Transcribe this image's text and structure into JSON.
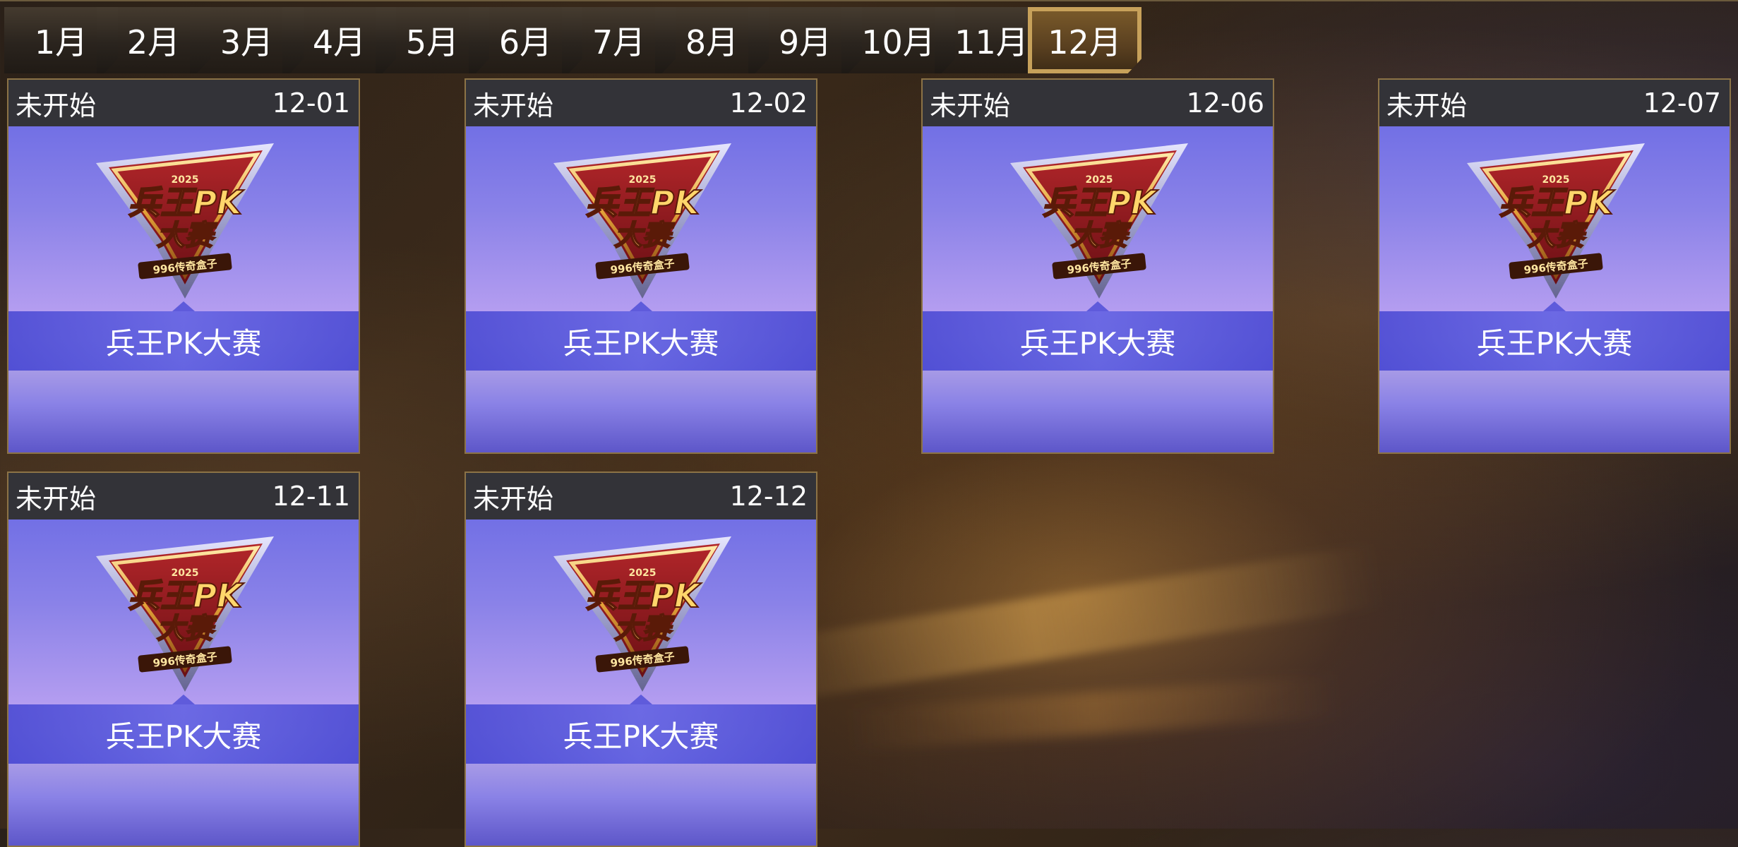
{
  "months": [
    {
      "label": "1月",
      "active": false
    },
    {
      "label": "2月",
      "active": false
    },
    {
      "label": "3月",
      "active": false
    },
    {
      "label": "4月",
      "active": false
    },
    {
      "label": "5月",
      "active": false
    },
    {
      "label": "6月",
      "active": false
    },
    {
      "label": "7月",
      "active": false
    },
    {
      "label": "8月",
      "active": false
    },
    {
      "label": "9月",
      "active": false
    },
    {
      "label": "10月",
      "active": false
    },
    {
      "label": "11月",
      "active": false
    },
    {
      "label": "12月",
      "active": true
    }
  ],
  "events": [
    {
      "status": "未开始",
      "date": "12-01",
      "title": "兵王PK大赛",
      "logo": {
        "year": "2025",
        "line1": "兵王PK",
        "line2": "大赛",
        "tag": "996传奇盒子"
      }
    },
    {
      "status": "未开始",
      "date": "12-02",
      "title": "兵王PK大赛",
      "logo": {
        "year": "2025",
        "line1": "兵王PK",
        "line2": "大赛",
        "tag": "996传奇盒子"
      }
    },
    {
      "status": "未开始",
      "date": "12-06",
      "title": "兵王PK大赛",
      "logo": {
        "year": "2025",
        "line1": "兵王PK",
        "line2": "大赛",
        "tag": "996传奇盒子"
      }
    },
    {
      "status": "未开始",
      "date": "12-07",
      "title": "兵王PK大赛",
      "logo": {
        "year": "2025",
        "line1": "兵王PK",
        "line2": "大赛",
        "tag": "996传奇盒子"
      }
    },
    {
      "status": "未开始",
      "date": "12-11",
      "title": "兵王PK大赛",
      "logo": {
        "year": "2025",
        "line1": "兵王PK",
        "line2": "大赛",
        "tag": "996传奇盒子"
      }
    },
    {
      "status": "未开始",
      "date": "12-12",
      "title": "兵王PK大赛",
      "logo": {
        "year": "2025",
        "line1": "兵王PK",
        "line2": "大赛",
        "tag": "996传奇盒子"
      }
    }
  ],
  "colors": {
    "tab_active_border": "#c7a15a",
    "card_header_bg": "#333338",
    "card_primary": "#6566e3",
    "card_band": "#5a5cd2"
  }
}
